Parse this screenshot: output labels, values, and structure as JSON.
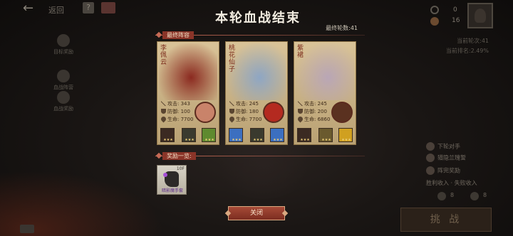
{
  "background": {
    "title": "返回",
    "help_label": "?",
    "resource_top": "0",
    "resource_bottom": "16",
    "sidebar": [
      {
        "label": "目标奖励"
      },
      {
        "label": "血战阵营"
      },
      {
        "label": "血战奖励"
      }
    ],
    "stats": {
      "rounds": "当前轮次:41",
      "rank": "当前排名:2.49%"
    },
    "panel": {
      "item1": "下轮对手",
      "item2": "猎隐兰瑰誓",
      "item3": "阵完奖励",
      "earnings": "胜利收入 · 失败收入",
      "left_count": "8",
      "right_count": "8"
    },
    "challenge_label": "挑 战"
  },
  "modal": {
    "title": "本轮血战结束",
    "rounds_label": "最终轮数:41",
    "lineup_label": "最终阵容",
    "rewards_label": "奖励一览:",
    "close_label": "关闭"
  },
  "cards": [
    {
      "name": "李佩云",
      "attack": "攻击: 343",
      "defense": "防御: 100",
      "hp": "生命: 7700",
      "theme": "#8b2a20",
      "main_skill_color": "#c9836a",
      "skill_colors": [
        "#3b2a22",
        "#3a3a2e",
        "#5f8a2f"
      ]
    },
    {
      "name": "桃花仙子",
      "attack": "攻击: 245",
      "defense": "防御: 180",
      "hp": "生命: 7700",
      "theme": "#8ea6c4",
      "main_skill_color": "#b42a20",
      "skill_colors": [
        "#3c6fc0",
        "#3a3a2e",
        "#3c6fc0"
      ]
    },
    {
      "name": "紫裙",
      "attack": "攻击: 245",
      "defense": "防御: 200",
      "hp": "生命: 6860",
      "theme": "#b9a6b6",
      "main_skill_color": "#5a3120",
      "skill_colors": [
        "#3b2a22",
        "#6a5a2e",
        "#d0a020"
      ]
    }
  ],
  "reward": {
    "count": "10F",
    "label": "暗影魔手套"
  }
}
